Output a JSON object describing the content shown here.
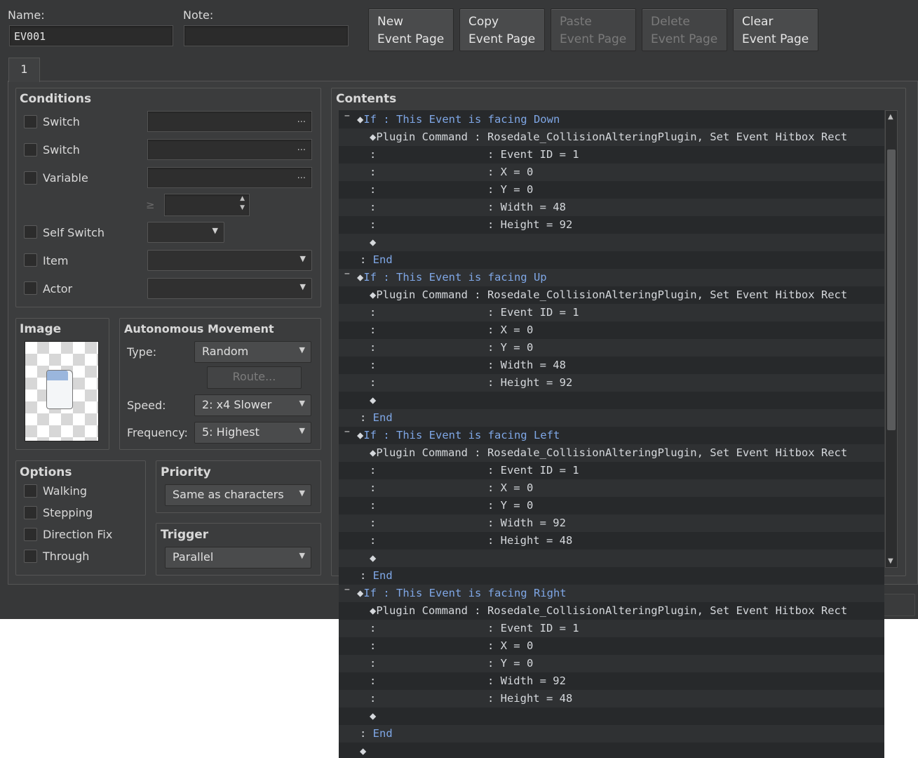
{
  "header": {
    "name_label": "Name:",
    "name_value": "EV001",
    "note_label": "Note:",
    "note_value": "",
    "buttons": [
      {
        "line1": "New",
        "line2": "Event Page",
        "enabled": true
      },
      {
        "line1": "Copy",
        "line2": "Event Page",
        "enabled": true
      },
      {
        "line1": "Paste",
        "line2": "Event Page",
        "enabled": false
      },
      {
        "line1": "Delete",
        "line2": "Event Page",
        "enabled": false
      },
      {
        "line1": "Clear",
        "line2": "Event Page",
        "enabled": true
      }
    ],
    "tab": "1"
  },
  "conditions": {
    "title": "Conditions",
    "switch1": "Switch",
    "switch2": "Switch",
    "variable": "Variable",
    "gte": "≥",
    "self_switch": "Self Switch",
    "item": "Item",
    "actor": "Actor",
    "dots": "..."
  },
  "image": {
    "title": "Image"
  },
  "movement": {
    "title": "Autonomous Movement",
    "type_label": "Type:",
    "type_value": "Random",
    "route_label": "Route...",
    "speed_label": "Speed:",
    "speed_value": "2: x4 Slower",
    "freq_label": "Frequency:",
    "freq_value": "5: Highest"
  },
  "options": {
    "title": "Options",
    "walking": "Walking",
    "stepping": "Stepping",
    "direction_fix": "Direction Fix",
    "through": "Through"
  },
  "priority": {
    "title": "Priority",
    "value": "Same as characters"
  },
  "trigger": {
    "title": "Trigger",
    "value": "Parallel"
  },
  "contents": {
    "title": "Contents",
    "lines": [
      {
        "collapse": "−",
        "prefix": "◆",
        "kw": "If",
        "sep": " : ",
        "text": "This Event is facing Down",
        "kwtext": true
      },
      {
        "indent": 2,
        "prefix": "◆",
        "text": "Plugin Command : Rosedale_CollisionAlteringPlugin, Set Event Hitbox Rect"
      },
      {
        "indent": 2,
        "text": ":                 : Event ID = 1"
      },
      {
        "indent": 2,
        "text": ":                 : X = 0"
      },
      {
        "indent": 2,
        "text": ":                 : Y = 0"
      },
      {
        "indent": 2,
        "text": ":                 : Width = 48"
      },
      {
        "indent": 2,
        "text": ":                 : Height = 92"
      },
      {
        "indent": 2,
        "text": "◆"
      },
      {
        "indent": 1,
        "text": ": ",
        "kw": "End"
      },
      {
        "collapse": "−",
        "prefix": "◆",
        "kw": "If",
        "sep": " : ",
        "text": "This Event is facing Up",
        "kwtext": true
      },
      {
        "indent": 2,
        "prefix": "◆",
        "text": "Plugin Command : Rosedale_CollisionAlteringPlugin, Set Event Hitbox Rect"
      },
      {
        "indent": 2,
        "text": ":                 : Event ID = 1"
      },
      {
        "indent": 2,
        "text": ":                 : X = 0"
      },
      {
        "indent": 2,
        "text": ":                 : Y = 0"
      },
      {
        "indent": 2,
        "text": ":                 : Width = 48"
      },
      {
        "indent": 2,
        "text": ":                 : Height = 92"
      },
      {
        "indent": 2,
        "text": "◆"
      },
      {
        "indent": 1,
        "text": ": ",
        "kw": "End"
      },
      {
        "collapse": "−",
        "prefix": "◆",
        "kw": "If",
        "sep": " : ",
        "text": "This Event is facing Left",
        "kwtext": true
      },
      {
        "indent": 2,
        "prefix": "◆",
        "text": "Plugin Command : Rosedale_CollisionAlteringPlugin, Set Event Hitbox Rect"
      },
      {
        "indent": 2,
        "text": ":                 : Event ID = 1"
      },
      {
        "indent": 2,
        "text": ":                 : X = 0"
      },
      {
        "indent": 2,
        "text": ":                 : Y = 0"
      },
      {
        "indent": 2,
        "text": ":                 : Width = 92"
      },
      {
        "indent": 2,
        "text": ":                 : Height = 48"
      },
      {
        "indent": 2,
        "text": "◆"
      },
      {
        "indent": 1,
        "text": ": ",
        "kw": "End"
      },
      {
        "collapse": "−",
        "prefix": "◆",
        "kw": "If",
        "sep": " : ",
        "text": "This Event is facing Right",
        "kwtext": true
      },
      {
        "indent": 2,
        "prefix": "◆",
        "text": "Plugin Command : Rosedale_CollisionAlteringPlugin, Set Event Hitbox Rect"
      },
      {
        "indent": 2,
        "text": ":                 : Event ID = 1"
      },
      {
        "indent": 2,
        "text": ":                 : X = 0"
      },
      {
        "indent": 2,
        "text": ":                 : Y = 0"
      },
      {
        "indent": 2,
        "text": ":                 : Width = 92"
      },
      {
        "indent": 2,
        "text": ":                 : Height = 48"
      },
      {
        "indent": 2,
        "text": "◆"
      },
      {
        "indent": 1,
        "text": ": ",
        "kw": "End"
      },
      {
        "indent": 1,
        "text": "◆"
      }
    ]
  }
}
